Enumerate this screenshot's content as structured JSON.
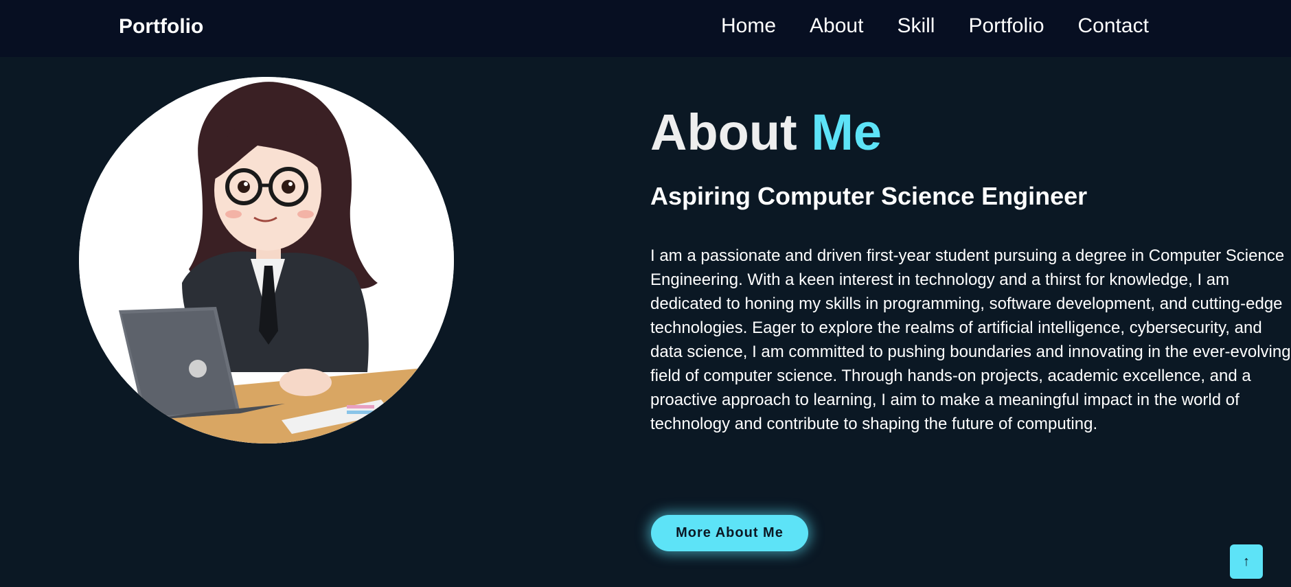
{
  "header": {
    "brand": "Portfolio",
    "nav": [
      "Home",
      "About",
      "Skill",
      "Portfolio",
      "Contact"
    ]
  },
  "avatar": {
    "alt": "illustrated avatar of student at laptop"
  },
  "about": {
    "title_main": "About ",
    "title_accent": "Me",
    "subtitle": "Aspiring Computer Science Engineer",
    "bio": "I am a passionate and driven first-year student pursuing a degree in Computer Science Engineering. With a keen interest in technology and a thirst for knowledge, I am dedicated to honing my skills in programming, software development, and cutting-edge technologies. Eager to explore the realms of artificial intelligence, cybersecurity, and data science, I am committed to pushing boundaries and innovating in the ever-evolving field of computer science. Through hands-on projects, academic excellence, and a proactive approach to learning, I aim to make a meaningful impact in the world of technology and contribute to shaping the future of computing.",
    "button_label": "More About Me"
  },
  "scroll_top": {
    "icon": "arrow-up-icon",
    "glyph": "↑"
  },
  "colors": {
    "background": "#0b1824",
    "header": "#070f22",
    "accent": "#5de3f7",
    "text": "#ffffff"
  }
}
